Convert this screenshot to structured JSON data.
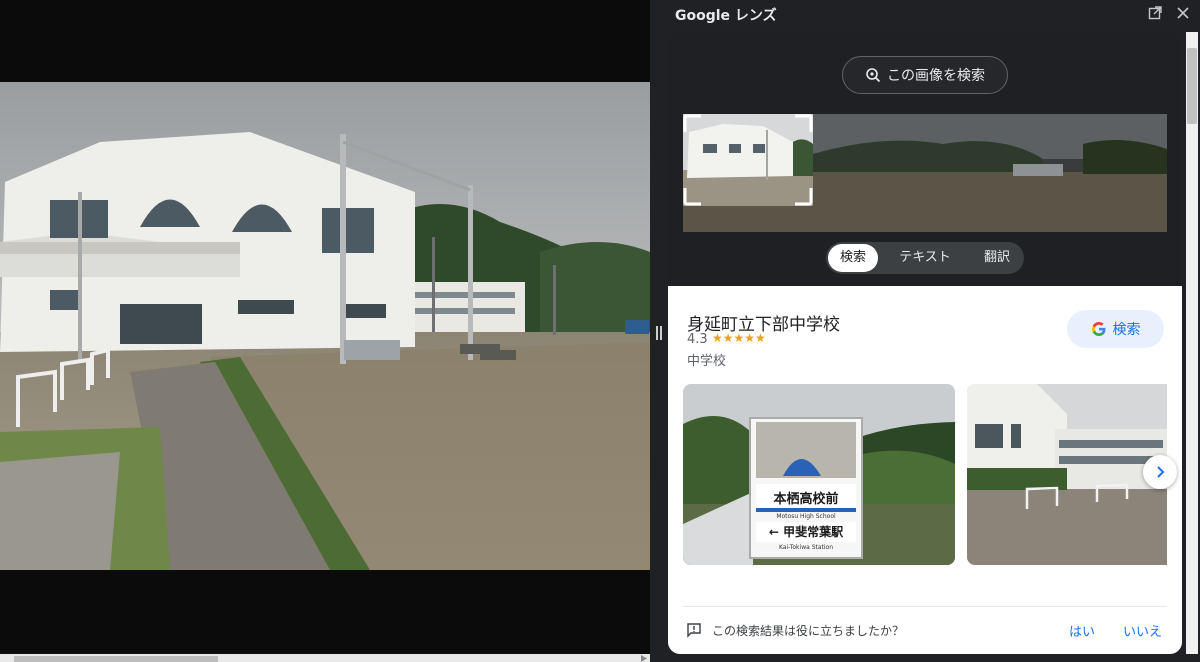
{
  "panel": {
    "title": "Google レンズ",
    "search_image_label": "この画像を検索",
    "tabs": [
      {
        "label": "検索",
        "selected": true
      },
      {
        "label": "テキスト",
        "selected": false
      },
      {
        "label": "翻訳",
        "selected": false
      }
    ]
  },
  "result": {
    "title": "身延町立下部中学校",
    "rating": "4.3",
    "stars": "★★★★★",
    "category": "中学校",
    "google_search_label": "検索"
  },
  "thumbnail1": {
    "sign_line1": "本栖高校前",
    "sign_line2": "Motosu High School",
    "sign_line3": "← 甲斐常葉駅",
    "sign_line4": "Kai-Tokiwa Station"
  },
  "feedback": {
    "question": "この検索結果は役に立ちましたか？",
    "yes": "はい",
    "no": "いいえ"
  },
  "colors": {
    "panel_bg": "#202124",
    "accent": "#1a73e8",
    "star": "#e8a317"
  }
}
